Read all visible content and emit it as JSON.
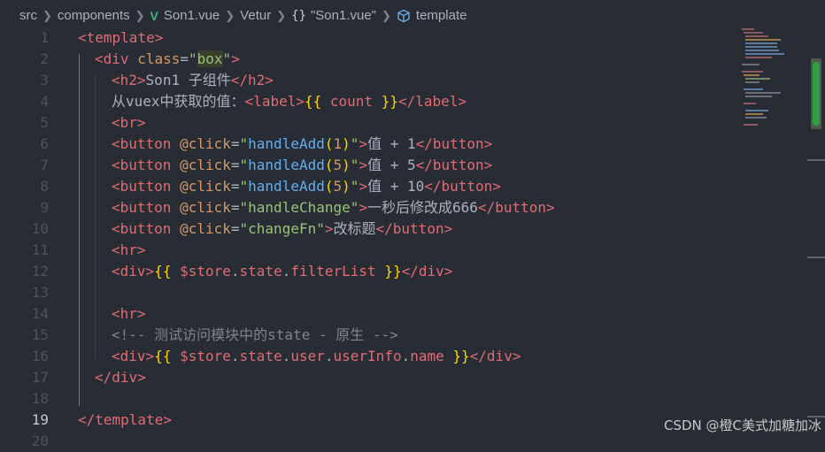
{
  "breadcrumb": {
    "items": [
      "src",
      "components",
      "Son1.vue",
      "Vetur",
      "\"Son1.vue\"",
      "template"
    ],
    "icons": {
      "vue": "vue-logo-icon",
      "braces": "braces-icon",
      "cube": "cube-icon"
    }
  },
  "editor": {
    "line_numbers": [
      "1",
      "2",
      "3",
      "4",
      "5",
      "6",
      "7",
      "8",
      "9",
      "10",
      "11",
      "12",
      "13",
      "14",
      "15",
      "16",
      "17",
      "18",
      "19",
      "20"
    ],
    "active_line": "19",
    "tokens": {
      "l1": [
        "<",
        "template",
        ">"
      ],
      "l2": [
        "<",
        "div",
        " ",
        "class",
        "=",
        "\"",
        "box",
        "\"",
        ">"
      ],
      "l3": [
        "<",
        "h2",
        ">",
        "Son1 子组件",
        "</",
        "h2",
        ">"
      ],
      "l4": [
        "从vuex中获取的值：",
        "<",
        "label",
        ">",
        "{{",
        " count ",
        "}}",
        "</",
        "label",
        ">"
      ],
      "l5": [
        "<",
        "br",
        ">"
      ],
      "l6": [
        "<",
        "button",
        " ",
        "@click",
        "=",
        "\"",
        "handleAdd",
        "(",
        "1",
        ")",
        "\"",
        ">",
        "值 + 1",
        "</",
        "button",
        ">"
      ],
      "l7": [
        "<",
        "button",
        " ",
        "@click",
        "=",
        "\"",
        "handleAdd",
        "(",
        "5",
        ")",
        "\"",
        ">",
        "值 + 5",
        "</",
        "button",
        ">"
      ],
      "l8": [
        "<",
        "button",
        " ",
        "@click",
        "=",
        "\"",
        "handleAdd",
        "(",
        "5",
        ")",
        "\"",
        ">",
        "值 + 10",
        "</",
        "button",
        ">"
      ],
      "l9": [
        "<",
        "button",
        " ",
        "@click",
        "=",
        "\"",
        "handleChange",
        "\"",
        ">",
        "一秒后修改成666",
        "</",
        "button",
        ">"
      ],
      "l10": [
        "<",
        "button",
        " ",
        "@click",
        "=",
        "\"",
        "changeFn",
        "\"",
        ">",
        "改标题",
        "</",
        "button",
        ">"
      ],
      "l11": [
        "<",
        "hr",
        ">"
      ],
      "l12": [
        "<",
        "div",
        ">",
        "{{",
        " $store",
        ".",
        "state",
        ".",
        "filterList",
        " ",
        "}}",
        "</",
        "div",
        ">"
      ],
      "l14": [
        "<",
        "hr",
        ">"
      ],
      "l15": [
        "<!-- 测试访问模块中的state - 原生 -->"
      ],
      "l16": [
        "<",
        "div",
        ">",
        "{{",
        " $store",
        ".",
        "state",
        ".",
        "user",
        ".",
        "userInfo",
        ".",
        "name",
        " ",
        "}}",
        "</",
        "div",
        ">"
      ],
      "l17": [
        "</",
        "div",
        ">"
      ],
      "l19": [
        "</",
        "template",
        ">"
      ]
    }
  },
  "watermark": "CSDN @橙C美式加糖加冰",
  "colors": {
    "background": "#282c34",
    "tag": "#e06c75",
    "attribute": "#d19a66",
    "string": "#98c379",
    "function": "#61afef",
    "bracket": "#ffd700",
    "comment": "#7f848e",
    "vue_green": "#41b883"
  }
}
